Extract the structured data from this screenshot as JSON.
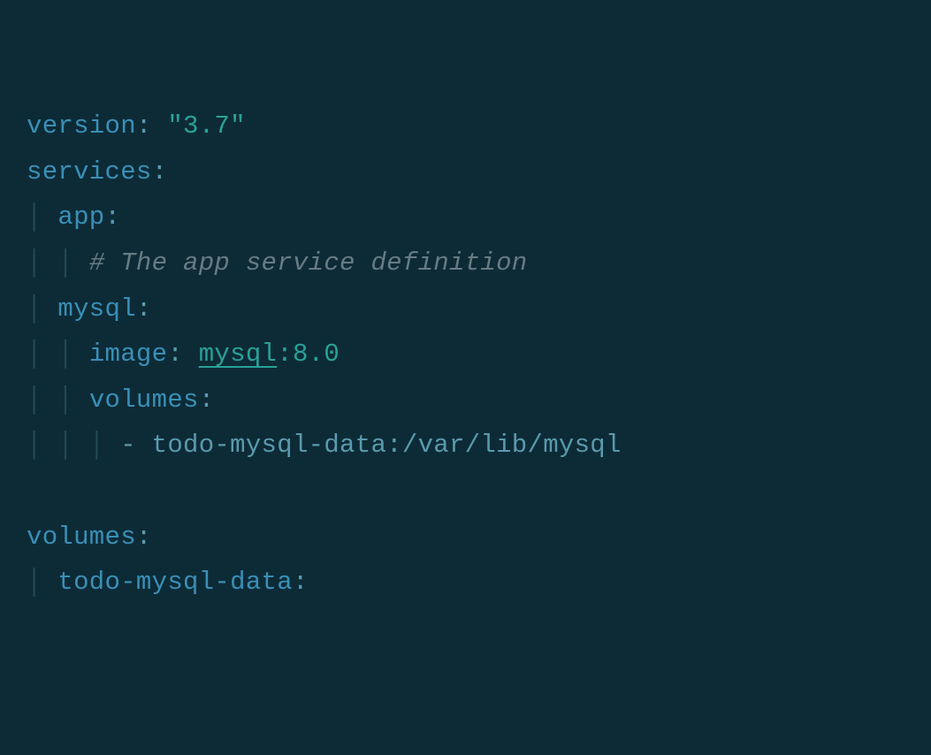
{
  "code": {
    "line1": {
      "key": "version",
      "colon": ":",
      "space": " ",
      "value": "\"3.7\""
    },
    "line2": {
      "key": "services",
      "colon": ":"
    },
    "line3": {
      "guide": "│ ",
      "key": "app",
      "colon": ":"
    },
    "line4": {
      "guide": "│ │ ",
      "comment": "# The app service definition"
    },
    "line5": {
      "guide": "│ ",
      "key": "mysql",
      "colon": ":"
    },
    "line6": {
      "guide": "│ │ ",
      "key": "image",
      "colon": ":",
      "space": " ",
      "value1": "mysql",
      "value2": ":8.0"
    },
    "line7": {
      "guide": "│ │ ",
      "key": "volumes",
      "colon": ":"
    },
    "line8": {
      "guide": "│ │ │ ",
      "dash": "- ",
      "value": "todo-mysql-data:/var/lib/mysql"
    },
    "blank": "",
    "line9": {
      "key": "volumes",
      "colon": ":"
    },
    "line10": {
      "guide": "│ ",
      "key": "todo-mysql-data",
      "colon": ":"
    }
  }
}
